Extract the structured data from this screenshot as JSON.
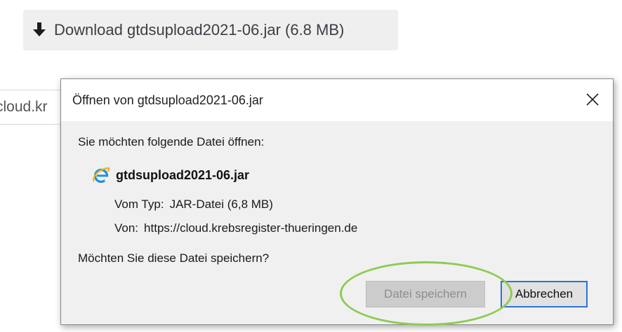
{
  "download_bar": {
    "icon": "download-arrow-icon",
    "label": "Download gtdsupload2021-06.jar (6.8 MB)"
  },
  "background_input": {
    "value": "cloud.kr"
  },
  "dialog": {
    "title": "Öffnen von gtdsupload2021-06.jar",
    "close_icon": "close-icon",
    "prompt": "Sie möchten folgende Datei öffnen:",
    "file_icon": "internet-explorer-icon",
    "file_name": "gtdsupload2021-06.jar",
    "type_label": "Vom Typ:",
    "type_value": "JAR-Datei (6,8 MB)",
    "from_label": "Von:",
    "from_value": "https://cloud.krebsregister-thueringen.de",
    "question": "Möchten Sie diese Datei speichern?",
    "save_button": "Datei speichern",
    "cancel_button": "Abbrechen"
  },
  "colors": {
    "highlight": "#8ccc52",
    "focus_border": "#2d72d6",
    "download_bar_bg": "#efefef",
    "dialog_bg": "#f0f0f0"
  }
}
